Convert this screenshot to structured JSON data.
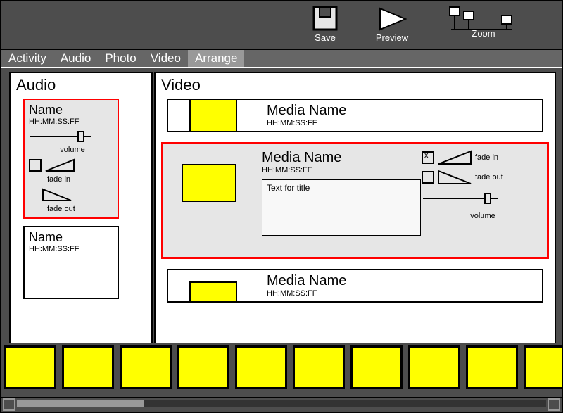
{
  "toolbar": {
    "save": "Save",
    "preview": "Preview",
    "zoom": "Zoom"
  },
  "tabs": {
    "activity": "Activity",
    "audio": "Audio",
    "photo": "Photo",
    "video": "Video",
    "arrange": "Arrange"
  },
  "audio": {
    "title": "Audio",
    "cards": [
      {
        "name": "Name",
        "time": "HH:MM:SS:FF",
        "volume": "volume",
        "fade_in": "fade in",
        "fade_out": "fade out"
      },
      {
        "name": "Name",
        "time": "HH:MM:SS:FF"
      }
    ]
  },
  "video": {
    "title": "Video",
    "items": [
      {
        "name": "Media Name",
        "time": "HH:MM:SS:FF"
      },
      {
        "name": "Media Name",
        "time": "HH:MM:SS:FF",
        "title_text": "Text for title",
        "fade_in": "fade in",
        "fade_out": "fade out",
        "volume": "volume"
      },
      {
        "name": "Media Name",
        "time": "HH:MM:SS:FF"
      }
    ]
  }
}
